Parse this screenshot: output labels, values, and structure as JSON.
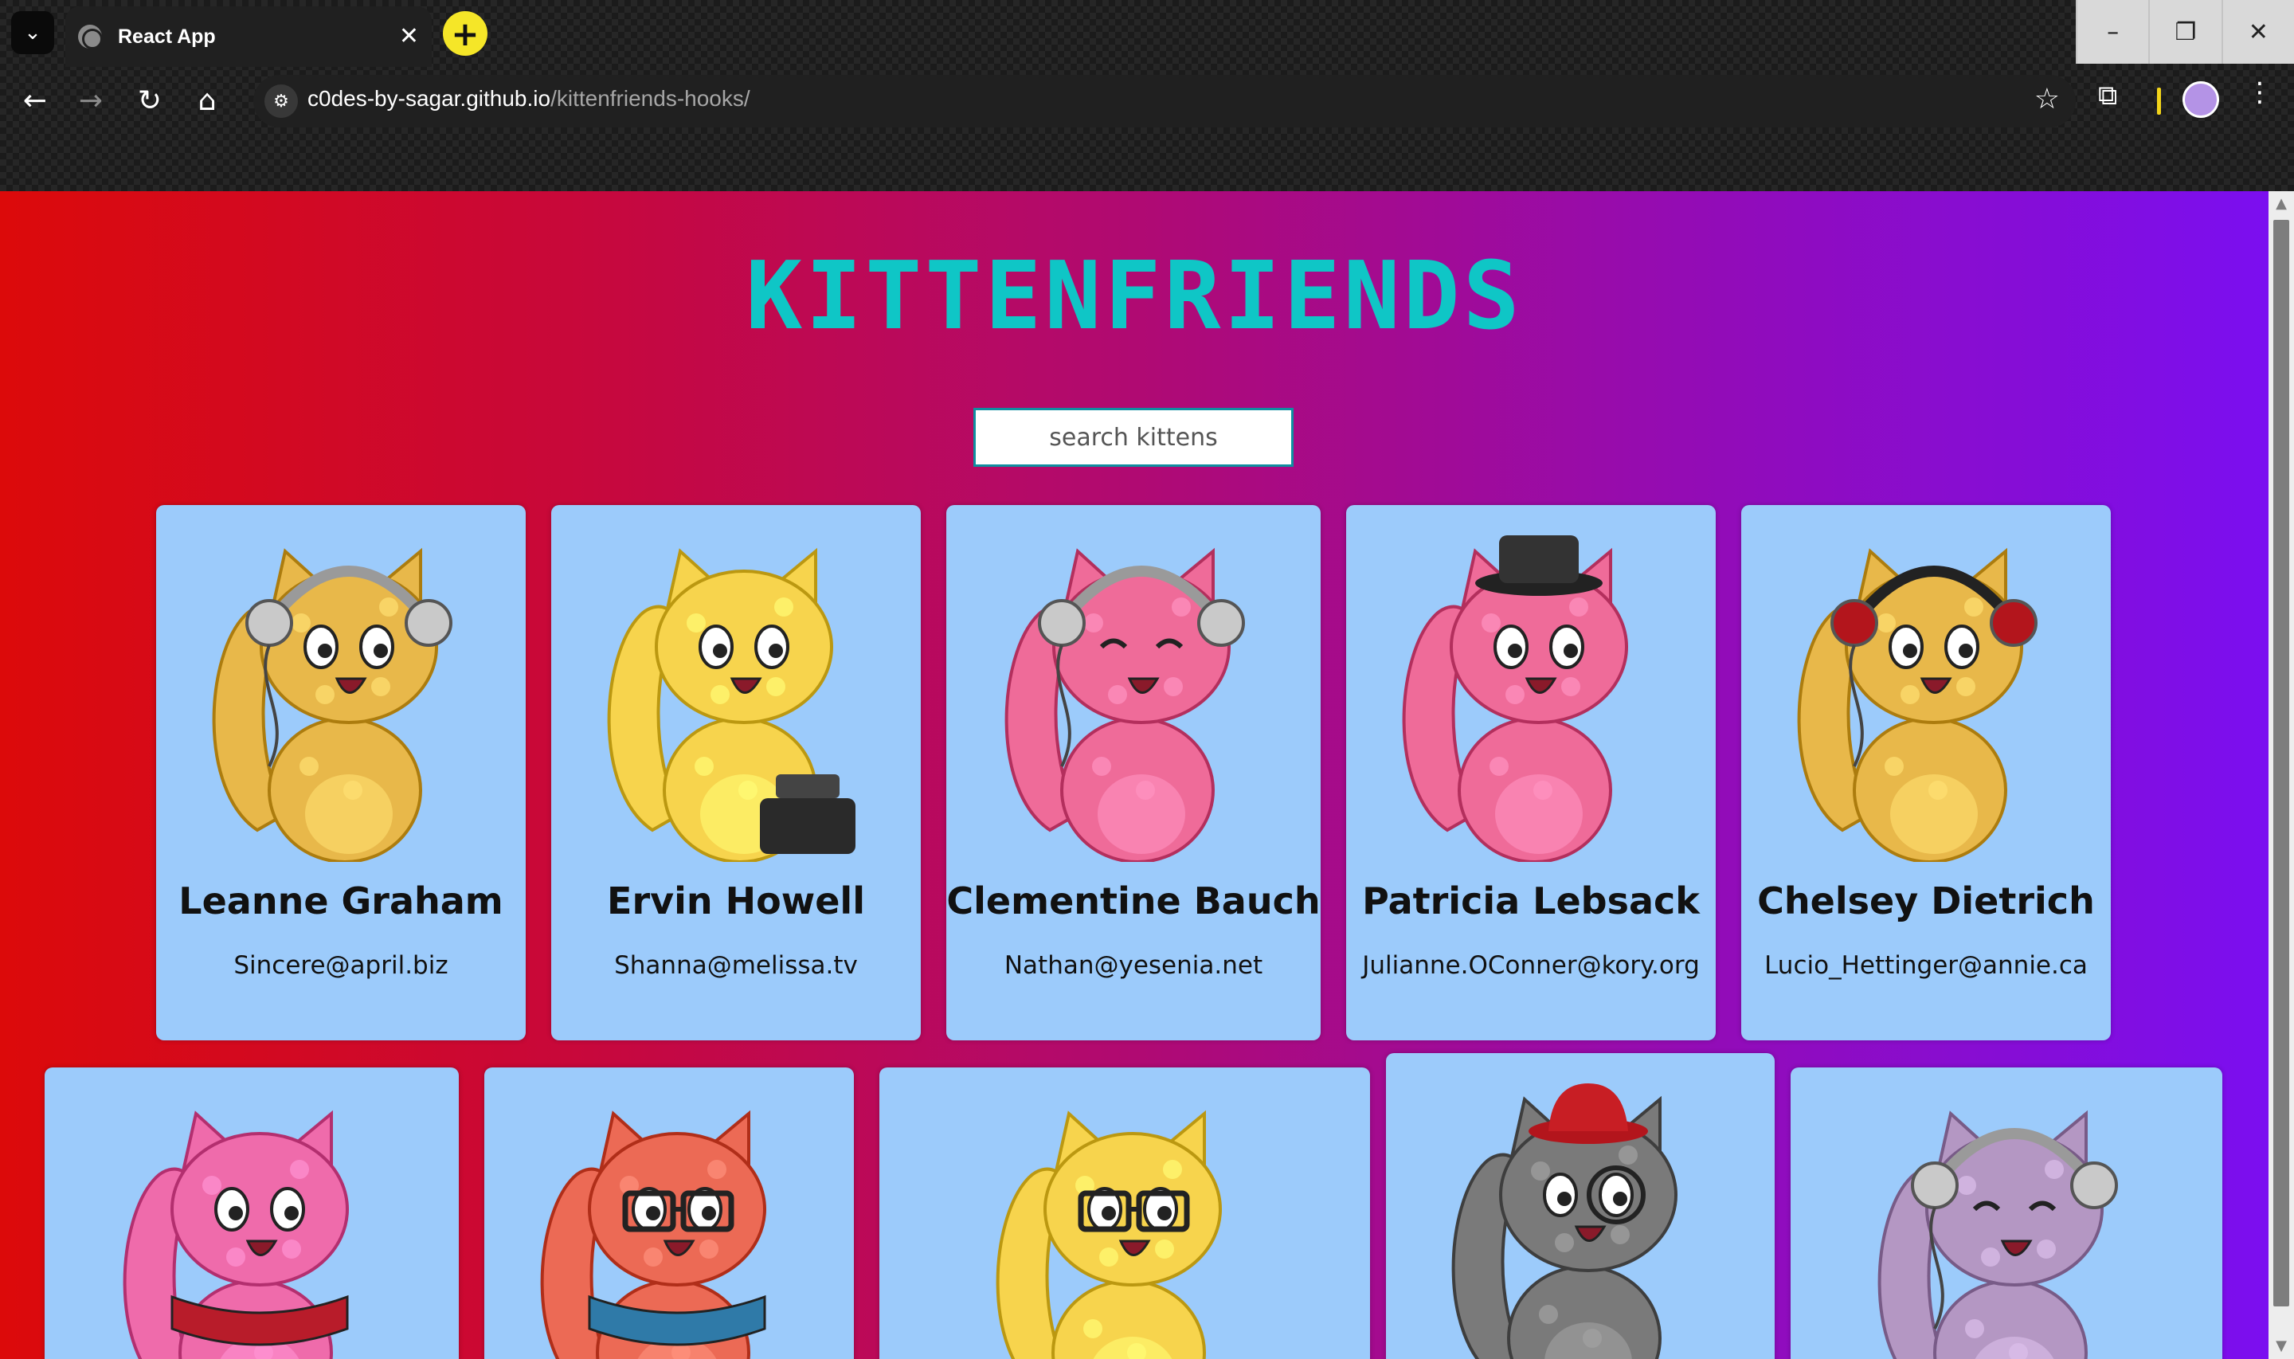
{
  "browser": {
    "tab_title": "React App",
    "url_host": "c0des-by-sagar.github.io",
    "url_path": "/kittenfriends-hooks/"
  },
  "app": {
    "brand": "KITTENFRIENDS",
    "search_placeholder": "search kittens"
  },
  "colors": {
    "gradient_start": "#dc0a0a",
    "gradient_end": "#7b0ef0",
    "card_bg": "#9ccbfb",
    "brand_color": "#0fc6c6"
  },
  "cards": [
    {
      "name": "Leanne Graham",
      "email": "Sincere@april.biz",
      "cat_color": "#e8b84a",
      "accessory": "headphones-silver"
    },
    {
      "name": "Ervin Howell",
      "email": "Shanna@melissa.tv",
      "cat_color": "#f7d44d",
      "accessory": "typewriter"
    },
    {
      "name": "Clementine Bauch",
      "email": "Nathan@yesenia.net",
      "cat_color": "#ef6b99",
      "accessory": "headphones-silver"
    },
    {
      "name": "Patricia Lebsack",
      "email": "Julianne.OConner@kory.org",
      "cat_color": "#ef6b99",
      "accessory": "top-hat"
    },
    {
      "name": "Chelsey Dietrich",
      "email": "Lucio_Hettinger@annie.ca",
      "cat_color": "#e8b84a",
      "accessory": "headphones-red"
    },
    {
      "cat_color": "#ef6bab",
      "accessory": "scarf-red"
    },
    {
      "cat_color": "#ec6a55",
      "accessory": "glasses-scarf-blue"
    },
    {
      "cat_color": "#f7d44d",
      "accessory": "glasses"
    },
    {
      "cat_color": "#7a7a7a",
      "accessory": "red-hat-monocle"
    },
    {
      "cat_color": "#b497c3",
      "accessory": "headphones-silver"
    }
  ]
}
